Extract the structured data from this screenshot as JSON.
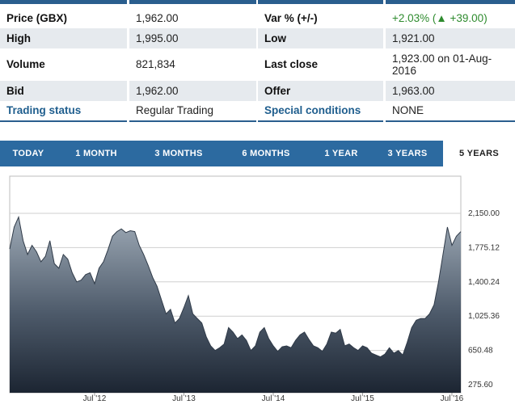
{
  "stats": {
    "rows": [
      {
        "l1": "Price (GBX)",
        "v1": "1,962.00",
        "l2": "Var % (+/-)",
        "v2": "+2.03% (▲ +39.00)"
      },
      {
        "l1": "High",
        "v1": "1,995.00",
        "l2": "Low",
        "v2": "1,921.00"
      },
      {
        "l1": "Volume",
        "v1": "821,834",
        "l2": "Last close",
        "v2": "1,923.00 on 01-Aug-2016"
      },
      {
        "l1": "Bid",
        "v1": "1,962.00",
        "l2": "Offer",
        "v2": "1,963.00"
      },
      {
        "l1": "Trading status",
        "v1": "Regular Trading",
        "l2": "Special conditions",
        "v2": "NONE"
      }
    ]
  },
  "tabs": [
    "TODAY",
    "1 MONTH",
    "3 MONTHS",
    "6 MONTHS",
    "1 YEAR",
    "3 YEARS",
    "5 YEARS"
  ],
  "active_tab": "5 YEARS",
  "colors": {
    "accent": "#2c6aa0",
    "positive": "#2e8b2e",
    "link": "#1f5e8e"
  },
  "chart_data": {
    "type": "area",
    "y_ticks": [
      "2,150.00",
      "1,775.12",
      "1,400.24",
      "1,025.36",
      "650.48",
      "275.60"
    ],
    "y_tick_values": [
      2150,
      1775.12,
      1400.24,
      1025.36,
      650.48,
      275.6
    ],
    "x_ticks": [
      "Jul '12",
      "Jul '13",
      "Jul '14",
      "Jul '15",
      "Jul '16"
    ],
    "x_tick_values": [
      2012.5,
      2013.5,
      2014.5,
      2015.5,
      2016.5
    ],
    "ylim": [
      275.6,
      2150
    ],
    "xlim": [
      2011.55,
      2016.6
    ],
    "grid": true,
    "x": [
      2011.55,
      2011.6,
      2011.65,
      2011.7,
      2011.75,
      2011.8,
      2011.85,
      2011.9,
      2011.95,
      2012.0,
      2012.05,
      2012.1,
      2012.15,
      2012.2,
      2012.25,
      2012.3,
      2012.35,
      2012.4,
      2012.45,
      2012.5,
      2012.55,
      2012.6,
      2012.65,
      2012.7,
      2012.75,
      2012.8,
      2012.85,
      2012.9,
      2012.95,
      2013.0,
      2013.05,
      2013.1,
      2013.15,
      2013.2,
      2013.25,
      2013.3,
      2013.35,
      2013.4,
      2013.45,
      2013.5,
      2013.55,
      2013.6,
      2013.65,
      2013.7,
      2013.75,
      2013.8,
      2013.85,
      2013.9,
      2013.95,
      2014.0,
      2014.05,
      2014.1,
      2014.15,
      2014.2,
      2014.25,
      2014.3,
      2014.35,
      2014.4,
      2014.45,
      2014.5,
      2014.55,
      2014.6,
      2014.65,
      2014.7,
      2014.75,
      2014.8,
      2014.85,
      2014.9,
      2014.95,
      2015.0,
      2015.05,
      2015.1,
      2015.15,
      2015.2,
      2015.25,
      2015.3,
      2015.35,
      2015.4,
      2015.45,
      2015.5,
      2015.55,
      2015.6,
      2015.65,
      2015.7,
      2015.75,
      2015.8,
      2015.85,
      2015.9,
      2015.95,
      2016.0,
      2016.05,
      2016.1,
      2016.15,
      2016.2,
      2016.25,
      2016.3,
      2016.35,
      2016.4,
      2016.45,
      2016.5,
      2016.55,
      2016.6
    ],
    "values": [
      1760,
      2000,
      2110,
      1850,
      1700,
      1800,
      1730,
      1620,
      1680,
      1850,
      1600,
      1550,
      1700,
      1650,
      1500,
      1400,
      1420,
      1480,
      1500,
      1380,
      1550,
      1620,
      1750,
      1900,
      1950,
      1980,
      1940,
      1960,
      1950,
      1800,
      1700,
      1580,
      1450,
      1350,
      1200,
      1050,
      1100,
      950,
      1000,
      1120,
      1250,
      1050,
      1000,
      950,
      800,
      700,
      650,
      680,
      720,
      900,
      850,
      780,
      820,
      760,
      650,
      700,
      850,
      900,
      780,
      700,
      640,
      690,
      700,
      680,
      760,
      820,
      850,
      770,
      700,
      680,
      640,
      720,
      850,
      840,
      880,
      700,
      720,
      680,
      650,
      700,
      680,
      620,
      600,
      580,
      610,
      680,
      620,
      650,
      600,
      740,
      900,
      980,
      1000,
      1000,
      1050,
      1150,
      1400,
      1700,
      2000,
      1800,
      1900,
      1950
    ]
  }
}
